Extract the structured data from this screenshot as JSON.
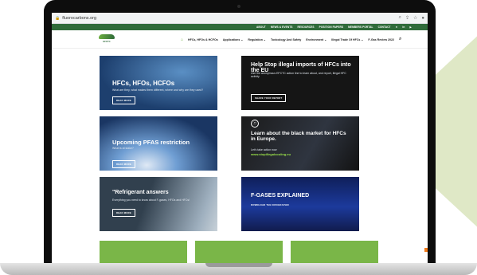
{
  "browser": {
    "url": "fluorocarbons.org"
  },
  "topnav": [
    "ABOUT",
    "NEWS & EVENTS",
    "RESOURCES",
    "POSITION PAPERS",
    "MEMBERS PORTAL",
    "CONTACT"
  ],
  "logo_text": "EFCTC",
  "menu": [
    "HFCs, HFOs & HCFOs",
    "Applications ⌄",
    "Regulation ⌄",
    "Toxicology And Safety",
    "Environment ⌄",
    "Illegal Trade Of HFCs ⌄",
    "F-Gas Review 2022"
  ],
  "tiles": {
    "t1": {
      "title": "HFCs, HFOs, HCFOs",
      "sub": "What are they, what makes them different, where and why are they used?",
      "btn": "READ MORE"
    },
    "t2": {
      "title": "Help Stop illegal imports of HFCs into the EU",
      "sub": "Use the anonymous EFCTC action line to learn about, and report, illegal HFC activity",
      "btn": "SHARE YOUR REPORT"
    },
    "t3": {
      "title": "Upcoming PFAS restriction",
      "sub": "What is at stake?",
      "btn": "READ MORE"
    },
    "t4": {
      "title": "Learn about the black market for HFCs in Europe.",
      "sub": "Let's take action now",
      "link": "www.stopillegalcooling.eu"
    },
    "t5": {
      "title": "\"Refrigerant answers",
      "sub": "Everything you need to know about F-gases, HFOs and HFCs!",
      "btn": "READ MORE"
    },
    "t6": {
      "title": "F-GASES EXPLAINED",
      "btn": "DOWNLOAD THE INFOGRAPHIC"
    }
  },
  "colors": {
    "brand_green": "#2f6b3a",
    "accent_green": "#7ab648",
    "highlight": "#9be34a"
  }
}
